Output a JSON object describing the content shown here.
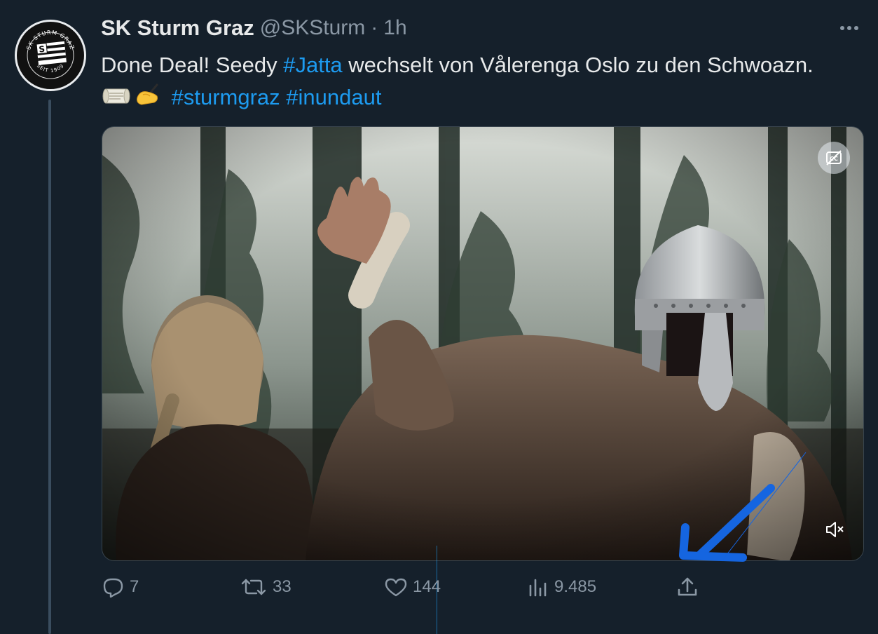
{
  "tweet": {
    "author_name": "SK Sturm Graz",
    "author_handle": "@SKSturm",
    "separator": "·",
    "time_ago": "1h",
    "text": {
      "part1": "Done Deal! Seedy ",
      "hashtag1": "#Jatta",
      "part2": " wechselt von Vålerenga Oslo zu den Schwoazn.",
      "hashtag2": "#sturmgraz",
      "hashtag3": "#inundaut"
    },
    "emojis": [
      "scroll-icon",
      "writing-hand-icon"
    ]
  },
  "avatar": {
    "logo_text_top": "SK STURM GRAZ",
    "logo_text_bottom": "SEIT 1909"
  },
  "media": {
    "type": "video",
    "controls": [
      "captions-off-icon",
      "mute-icon"
    ]
  },
  "actions": {
    "replies": "7",
    "retweets": "33",
    "likes": "144",
    "views": "9.485"
  },
  "colors": {
    "background": "#15202b",
    "text": "#e7e9ea",
    "muted": "#8b98a5",
    "accent": "#1d9bf0",
    "thread_line": "#3a4d5f",
    "annotation": "#1565e0"
  }
}
